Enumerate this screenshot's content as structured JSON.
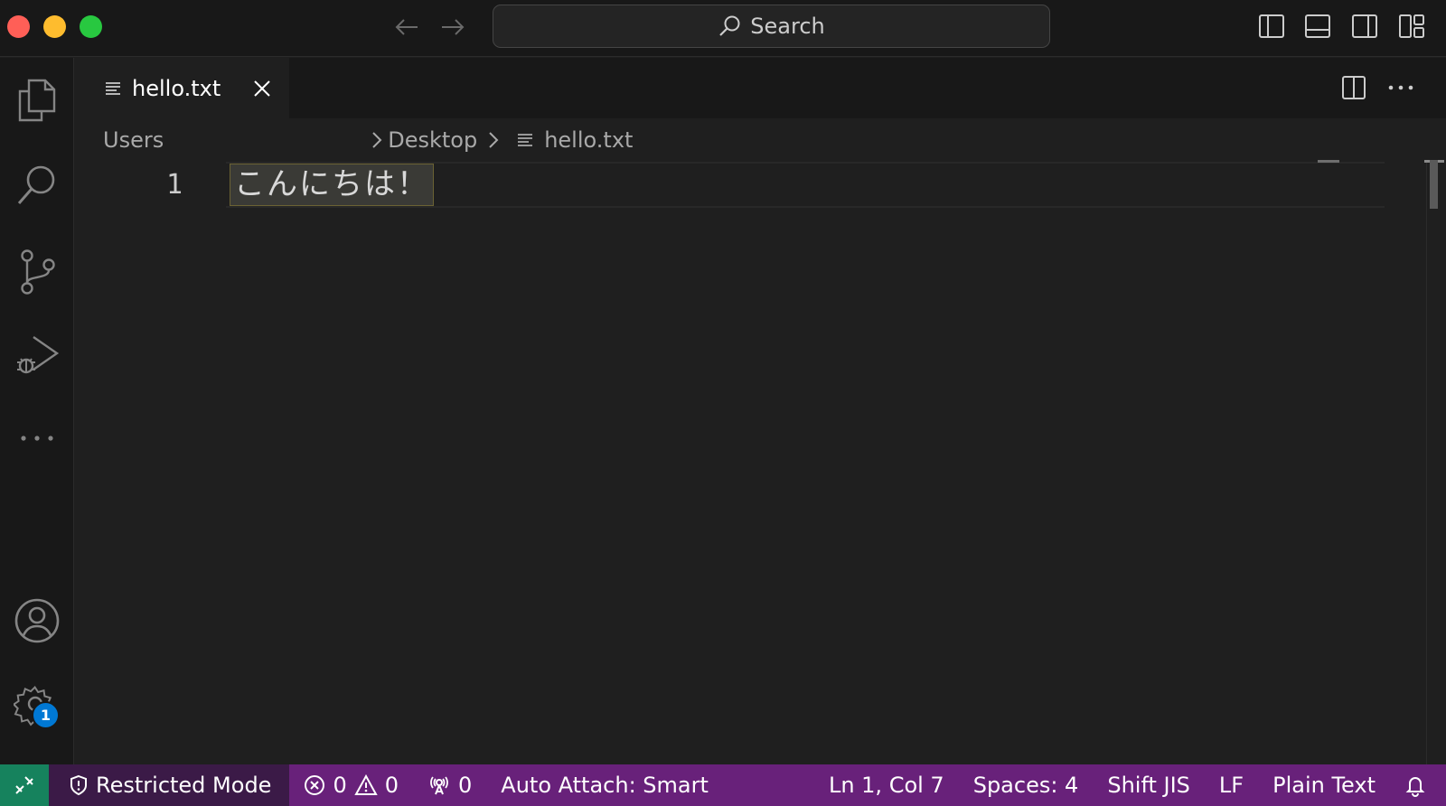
{
  "titlebar": {
    "search_label": "Search"
  },
  "activitybar": {
    "settings_badge": "1"
  },
  "tabs": [
    {
      "label": "hello.txt"
    }
  ],
  "breadcrumb": {
    "root": "Users",
    "folder": "Desktop",
    "file": "hello.txt"
  },
  "editor": {
    "lines": [
      {
        "number": "1",
        "text": "こんにちは！"
      }
    ]
  },
  "statusbar": {
    "restricted_mode": "Restricted Mode",
    "errors": "0",
    "warnings": "0",
    "ports": "0",
    "auto_attach": "Auto Attach: Smart",
    "cursor_position": "Ln 1, Col 7",
    "indentation": "Spaces: 4",
    "encoding": "Shift JIS",
    "eol": "LF",
    "language": "Plain Text"
  },
  "colors": {
    "status_bar": "#68217a",
    "restricted_bg": "#3b1a47",
    "remote_bg": "#16825d",
    "badge": "#0078d4",
    "traffic_red": "#ff5f57",
    "traffic_yellow": "#febc2e",
    "traffic_green": "#28c840"
  },
  "icons": {
    "traffic": [
      "close-window-icon",
      "minimize-window-icon",
      "maximize-window-icon"
    ],
    "titlebar": [
      "arrow-left-icon",
      "arrow-right-icon",
      "search-icon",
      "toggle-primary-sidebar-icon",
      "toggle-panel-icon",
      "toggle-secondary-sidebar-icon",
      "customize-layout-icon"
    ],
    "activitybar": [
      "explorer-files-icon",
      "search-icon",
      "source-control-icon",
      "run-and-debug-icon",
      "more-icon",
      "accounts-icon",
      "manage-gear-icon"
    ],
    "statusbar": [
      "remote-icon",
      "shield-icon",
      "error-icon",
      "warning-icon",
      "broadcast-icon",
      "bell-icon"
    ]
  }
}
